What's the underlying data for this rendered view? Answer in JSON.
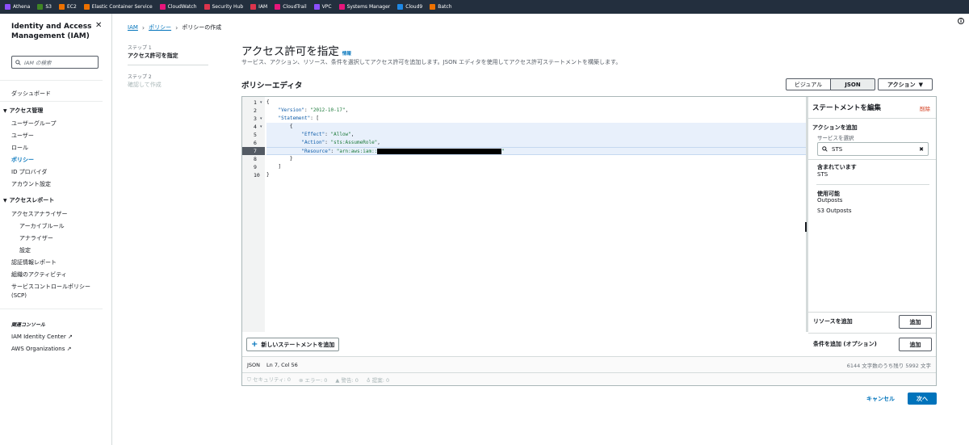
{
  "favorites": [
    {
      "label": "Athena",
      "color": "#8c4fff"
    },
    {
      "label": "S3",
      "color": "#3f8624"
    },
    {
      "label": "EC2",
      "color": "#ed7100"
    },
    {
      "label": "Elastic Container Service",
      "color": "#ed7100"
    },
    {
      "label": "CloudWatch",
      "color": "#e7157b"
    },
    {
      "label": "Security Hub",
      "color": "#dd344c"
    },
    {
      "label": "IAM",
      "color": "#dd344c"
    },
    {
      "label": "CloudTrail",
      "color": "#e7157b"
    },
    {
      "label": "VPC",
      "color": "#8c4fff"
    },
    {
      "label": "Systems Manager",
      "color": "#e7157b"
    },
    {
      "label": "Cloud9",
      "color": "#1e88e5"
    },
    {
      "label": "Batch",
      "color": "#ed7100"
    }
  ],
  "sidebar": {
    "title": "Identity and Access Management (IAM)",
    "search_placeholder": "IAM の検索",
    "dashboard": "ダッシュボード",
    "access_management": "アクセス管理",
    "user_groups": "ユーザーグループ",
    "users": "ユーザー",
    "roles": "ロール",
    "policies": "ポリシー",
    "id_providers": "ID プロバイダ",
    "account_settings": "アカウント設定",
    "access_reports": "アクセスレポート",
    "access_analyzer": "アクセスアナライザー",
    "archive_rules": "アーカイブルール",
    "analyzers": "アナライザー",
    "settings": "設定",
    "credential_report": "認証情報レポート",
    "org_activity": "組織のアクティビティ",
    "scp_line1": "サービスコントロールポリシー",
    "scp_line2": "(SCP)",
    "related_consoles": "関連コンソール",
    "identity_center": "IAM Identity Center",
    "organizations": "AWS Organizations"
  },
  "breadcrumb": {
    "iam": "IAM",
    "policies": "ポリシー",
    "current": "ポリシーの作成"
  },
  "steps": {
    "step1_label": "ステップ 1",
    "step1_title": "アクセス許可を指定",
    "step2_label": "ステップ 2",
    "step2_title": "確認して作成"
  },
  "main": {
    "title": "アクセス許可を指定",
    "info": "情報",
    "description": "サービス、アクション、リソース、条件を選択してアクセス許可を追加します。JSON エディタを使用してアクセス許可ステートメントを構築します。",
    "editor_heading": "ポリシーエディタ",
    "visual_label": "ビジュアル",
    "json_label": "JSON",
    "action_label": "アクション"
  },
  "editor": {
    "lines": [
      {
        "num": "1",
        "fold": "▾"
      },
      {
        "num": "2",
        "fold": ""
      },
      {
        "num": "3",
        "fold": "▾"
      },
      {
        "num": "4",
        "fold": "▾"
      },
      {
        "num": "5",
        "fold": ""
      },
      {
        "num": "6",
        "fold": ""
      },
      {
        "num": "7",
        "fold": ""
      },
      {
        "num": "8",
        "fold": ""
      },
      {
        "num": "9",
        "fold": ""
      },
      {
        "num": "10",
        "fold": ""
      }
    ],
    "code": {
      "l1": "{",
      "l2_key": "\"Version\"",
      "l2_val": "\"2012-10-17\"",
      "l3_key": "\"Statement\"",
      "l3_rest": ": [",
      "l4": "{",
      "l5_key": "\"Effect\"",
      "l5_val": "\"Allow\"",
      "l6_key": "\"Action\"",
      "l6_val": "\"sts:AssumeRole\"",
      "l7_key": "\"Resource\"",
      "l7_val": "\"arn:aws:iam::",
      "l7_end": "\"",
      "l8": "}",
      "l9": "]",
      "l10": "}"
    },
    "add_statement": "新しいステートメントを追加",
    "mode": "JSON",
    "position": "Ln 7, Col 56",
    "char_count": "6144 文字数のうち残り 5992 文字",
    "security": "セキュリティ: 0",
    "errors": "エラー: 0",
    "warnings": "警告: 0",
    "suggestions": "提案: 0"
  },
  "statement_panel": {
    "title": "ステートメントを編集",
    "delete": "削除",
    "add_actions": "アクションを追加",
    "select_service": "サービスを選択",
    "search_value": "STS",
    "included": "含まれています",
    "included_item": "STS",
    "available": "使用可能",
    "available_items": [
      "Outposts",
      "S3 Outposts"
    ],
    "add_resource": "リソースを追加",
    "add_condition": "条件を追加 (オプション)",
    "add_button": "追加"
  },
  "footer": {
    "cancel": "キャンセル",
    "next": "次へ"
  }
}
